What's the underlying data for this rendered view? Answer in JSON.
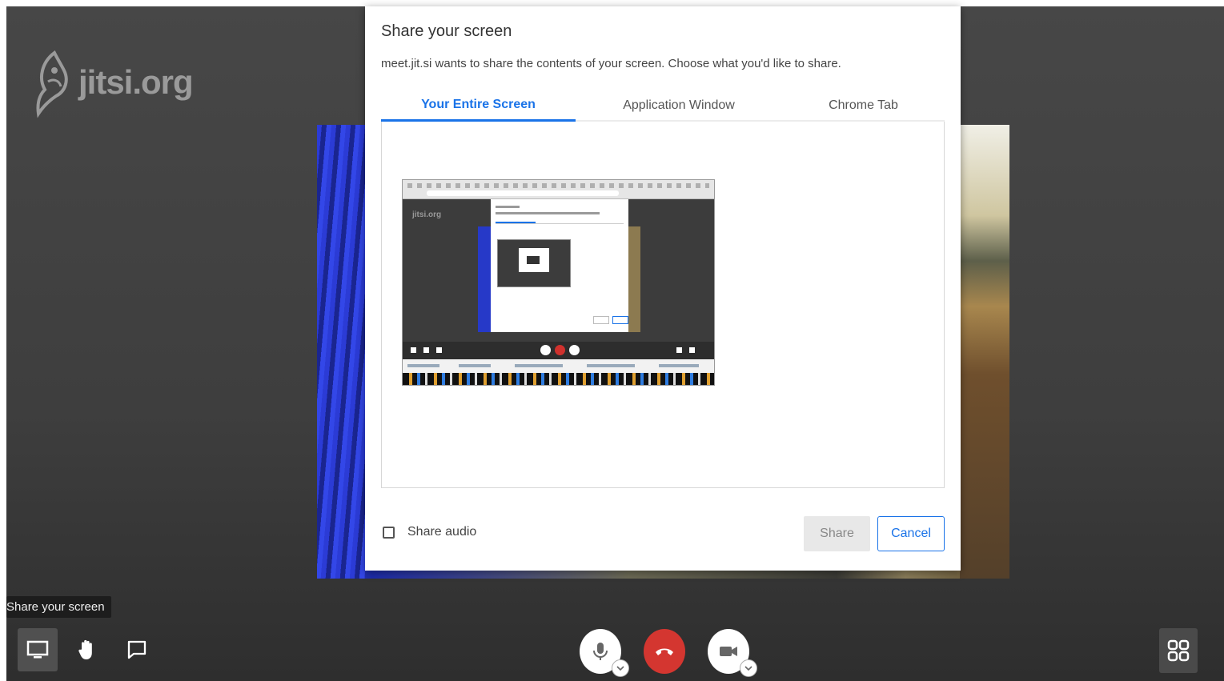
{
  "brand": {
    "logo_text": "jitsi.org"
  },
  "dialog": {
    "title": "Share your screen",
    "description": "meet.jit.si wants to share the contents of your screen. Choose what you'd like to share.",
    "tabs": [
      {
        "label": "Your Entire Screen",
        "active": true
      },
      {
        "label": "Application Window",
        "active": false
      },
      {
        "label": "Chrome Tab",
        "active": false
      }
    ],
    "share_audio_label": "Share audio",
    "share_audio_checked": false,
    "share_button": "Share",
    "cancel_button": "Cancel"
  },
  "tooltip": {
    "text": "Share your screen"
  },
  "toolbar": {
    "left": [
      {
        "icon": "screen-share-icon",
        "active": true
      },
      {
        "icon": "raise-hand-icon",
        "active": false
      },
      {
        "icon": "chat-icon",
        "active": false
      }
    ],
    "center": [
      {
        "icon": "microphone-icon"
      },
      {
        "icon": "hangup-icon"
      },
      {
        "icon": "camera-icon"
      }
    ],
    "right": [
      {
        "icon": "tile-view-icon"
      }
    ]
  },
  "colors": {
    "accent": "#1a73e8",
    "hangup": "#d43630",
    "background": "#3f3f3f"
  }
}
